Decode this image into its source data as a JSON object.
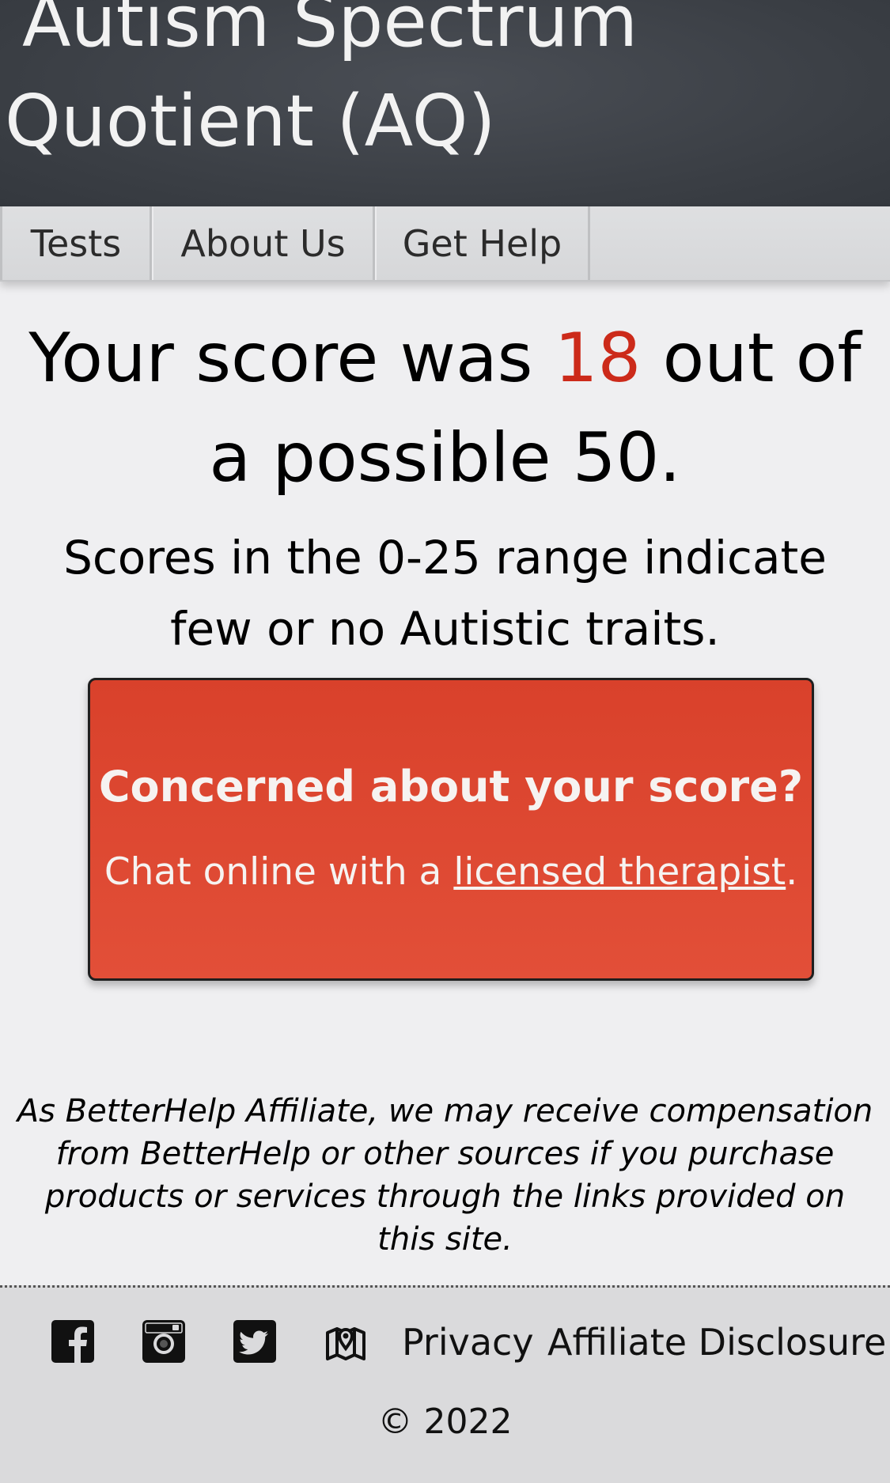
{
  "header": {
    "title_line1": "Autism Spectrum",
    "title_line2": "Quotient (AQ)"
  },
  "nav": {
    "tabs": [
      {
        "label": "Tests"
      },
      {
        "label": "About Us"
      },
      {
        "label": "Get Help"
      }
    ]
  },
  "result": {
    "prefix": "Your score was ",
    "score": "18",
    "suffix": " out of a possible 50.",
    "score_color": "#cc2a1a",
    "range_text": "Scores in the 0-25 range indicate few or no Autistic traits."
  },
  "cta": {
    "title": "Concerned about your score?",
    "text_prefix": "Chat online with a ",
    "link_text": "licensed therapist",
    "text_suffix": ".",
    "background_color": "#de4731"
  },
  "disclaimer": "As BetterHelp Affiliate, we may receive compensation from BetterHelp or other sources if you purchase products or services through the links provided on this site.",
  "footer": {
    "icons": [
      "facebook-icon",
      "instagram-icon",
      "twitter-icon",
      "map-icon"
    ],
    "links": [
      {
        "label": "Privacy"
      },
      {
        "label": "Affiliate Disclosure"
      }
    ],
    "copyright": "© 2022"
  }
}
